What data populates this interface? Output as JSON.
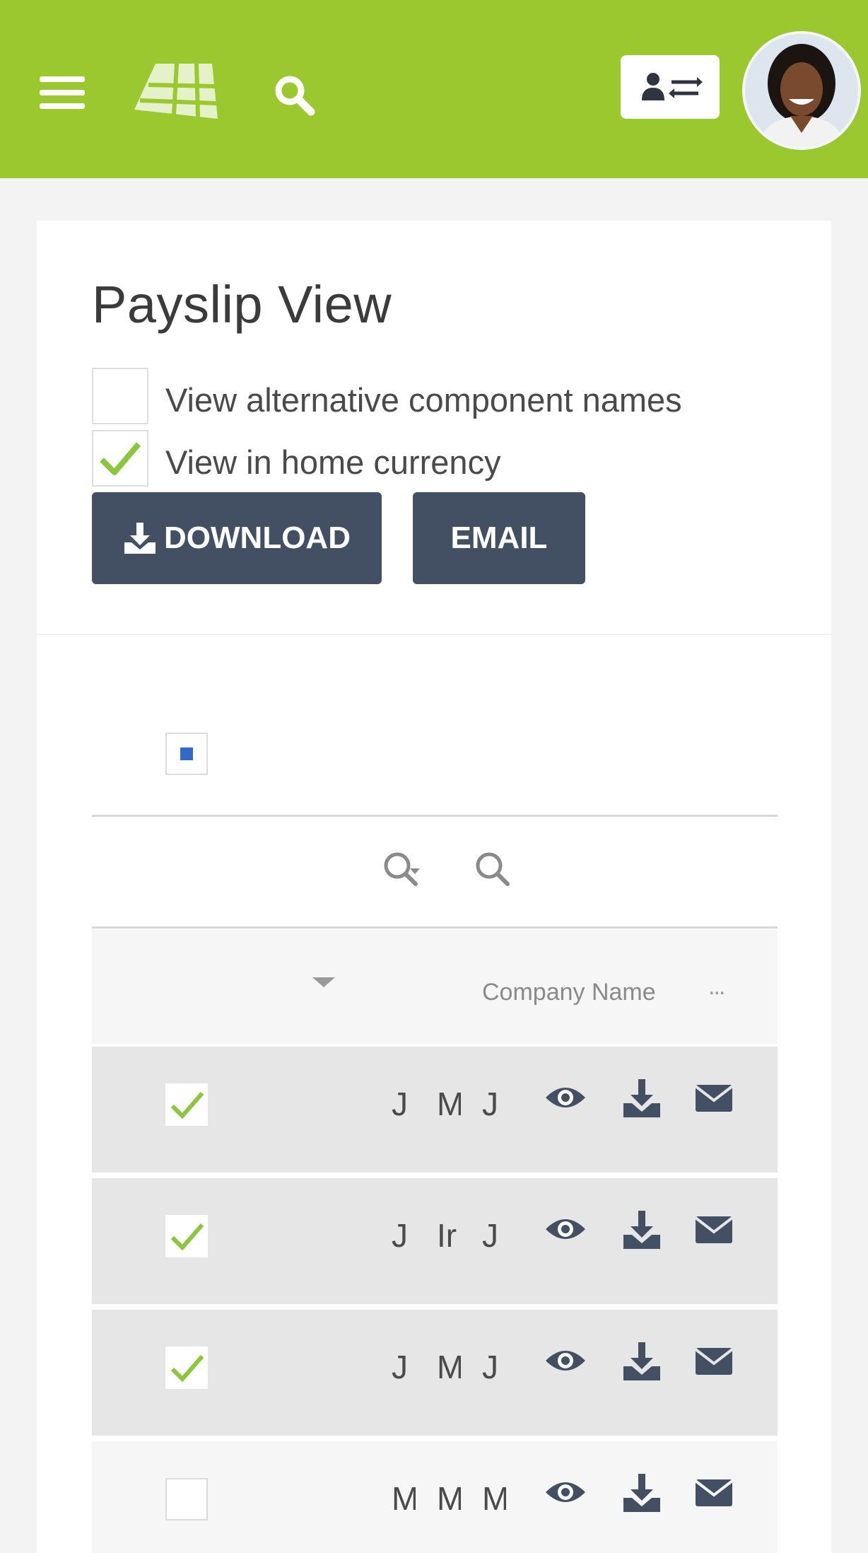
{
  "page": {
    "title": "Payslip View",
    "options": [
      {
        "label": "View alternative component names",
        "checked": false
      },
      {
        "label": "View in home currency",
        "checked": true
      }
    ],
    "buttons": {
      "download": "DOWNLOAD",
      "email": "EMAIL"
    }
  },
  "table": {
    "column_header": "Company Name",
    "more_label": "...",
    "rows": [
      {
        "checked": true,
        "cells": [
          "J",
          "M",
          "J"
        ]
      },
      {
        "checked": true,
        "cells": [
          "J",
          "Ir",
          "J"
        ]
      },
      {
        "checked": true,
        "cells": [
          "J",
          "M",
          "J"
        ]
      },
      {
        "checked": false,
        "cells": [
          "M",
          "M",
          "M"
        ]
      }
    ]
  },
  "colors": {
    "header_green": "#9bc72f",
    "button_dark": "#434f63",
    "icon_dark": "#434f63",
    "check_green": "#8cc63f",
    "row_checked_bg": "#e6e6e6",
    "row_unchecked_bg": "#f6f6f6",
    "select_blue": "#2f6bc6"
  },
  "icons": {
    "menu": "hamburger-icon",
    "logo": "logo-icon",
    "search": "search-icon",
    "switch_user": "user-switch-icon",
    "filter_search": "search-filter-icon",
    "table_search": "search-icon",
    "row_view": "eye-icon",
    "row_download": "download-icon",
    "row_email": "envelope-icon"
  }
}
